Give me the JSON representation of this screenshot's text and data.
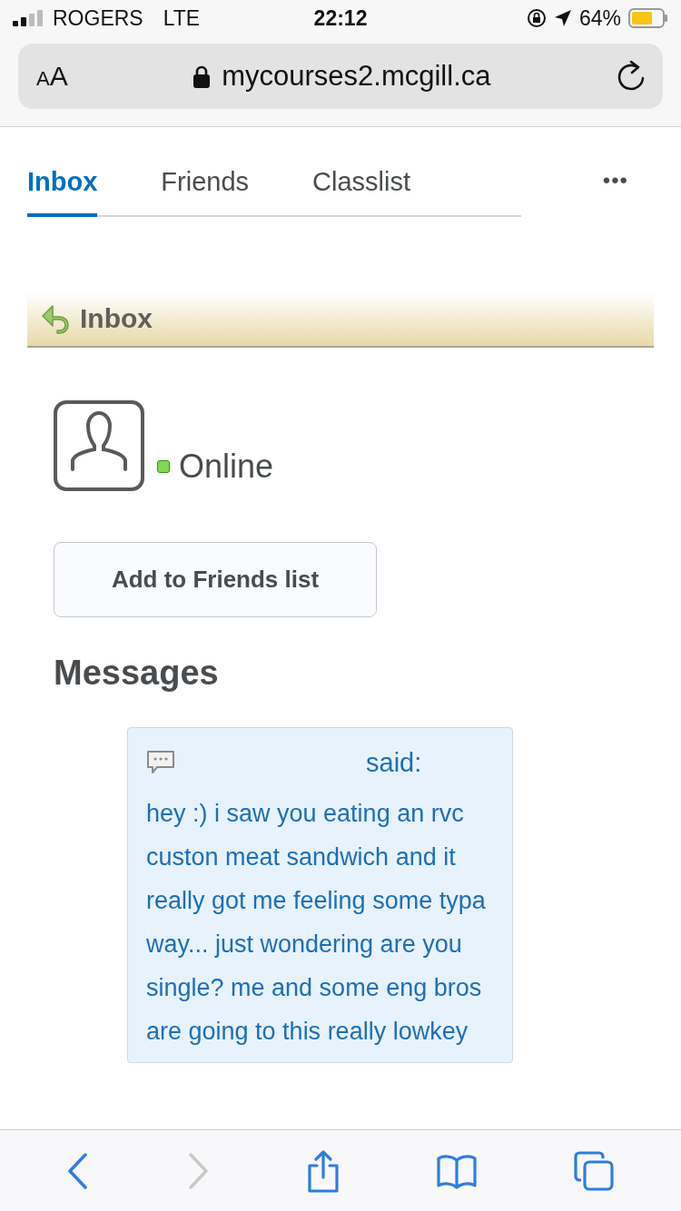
{
  "status_bar": {
    "carrier": "ROGERS",
    "network": "LTE",
    "time": "22:12",
    "battery": "64%"
  },
  "address_bar": {
    "text_size": "AA",
    "url": "mycourses2.mcgill.ca"
  },
  "tabs": [
    {
      "label": "Inbox",
      "selected": true
    },
    {
      "label": "Friends",
      "selected": false
    },
    {
      "label": "Classlist",
      "selected": false
    }
  ],
  "more": "•••",
  "section_title": "Inbox",
  "profile": {
    "status": "Online",
    "online": true,
    "button": "Add to Friends list"
  },
  "messages_heading": "Messages",
  "message": {
    "said": "said:",
    "body": "hey :) i saw you eating an rvc custon meat sandwich and it really got me feeling some typa way... just wondering are you single? me and some eng bros are going to this really lowkey"
  },
  "toolbar": {
    "back_enabled": true,
    "forward_enabled": false
  }
}
